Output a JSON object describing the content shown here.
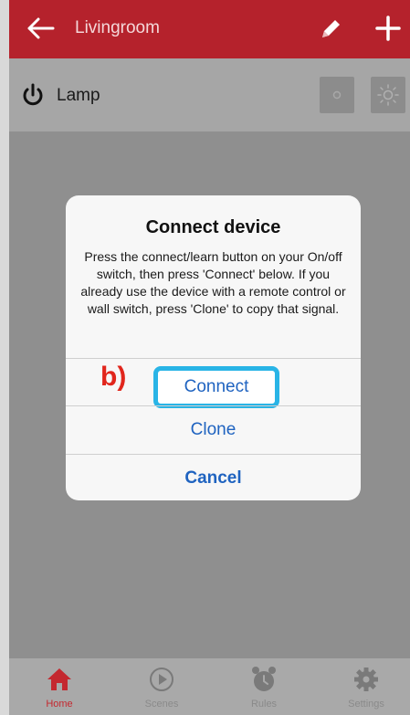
{
  "header": {
    "title": "Livingroom"
  },
  "device": {
    "name": "Lamp"
  },
  "dialog": {
    "title": "Connect device",
    "message": "Press the connect/learn button on your On/off switch, then press 'Connect' below. If you already use the device with a remote control or wall switch, press 'Clone' to copy that signal.",
    "connect_label": "Connect",
    "clone_label": "Clone",
    "cancel_label": "Cancel"
  },
  "annotation": {
    "step": "b)"
  },
  "nav": {
    "items": [
      {
        "label": "Home",
        "icon": "home-icon"
      },
      {
        "label": "Scenes",
        "icon": "play-icon"
      },
      {
        "label": "Rules",
        "icon": "alarm-icon"
      },
      {
        "label": "Settings",
        "icon": "gear-icon"
      }
    ]
  },
  "colors": {
    "header": "#b5222c",
    "accent": "#1f63c0",
    "highlight": "#29b4e6",
    "annotation": "#e1261c"
  }
}
